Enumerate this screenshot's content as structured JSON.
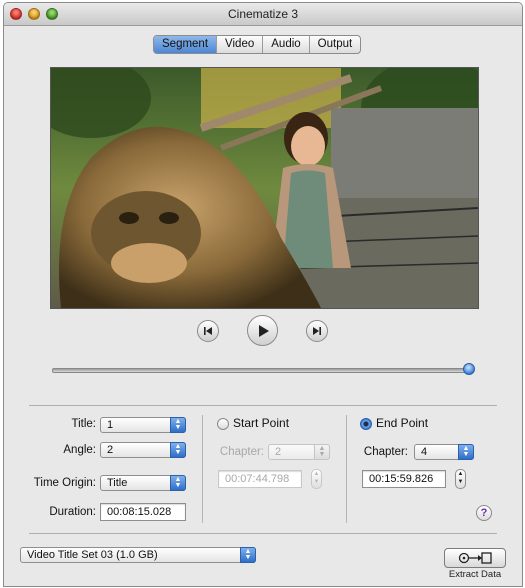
{
  "window": {
    "title": "Cinematize 3"
  },
  "tabs": [
    {
      "label": "Segment",
      "active": true
    },
    {
      "label": "Video",
      "active": false
    },
    {
      "label": "Audio",
      "active": false
    },
    {
      "label": "Output",
      "active": false
    }
  ],
  "playback": {
    "previous_icon": "skip-back-icon",
    "play_icon": "play-icon",
    "next_icon": "skip-forward-icon",
    "position_fraction": 1.0
  },
  "settings": {
    "title_label": "Title:",
    "title_value": "1",
    "angle_label": "Angle:",
    "angle_value": "2",
    "time_origin_label": "Time Origin:",
    "time_origin_value": "Title",
    "duration_label": "Duration:",
    "duration_value": "00:08:15.028"
  },
  "start_point": {
    "label": "Start Point",
    "selected": false,
    "chapter_label": "Chapter:",
    "chapter_value": "2",
    "time_value": "00:07:44.798"
  },
  "end_point": {
    "label": "End Point",
    "selected": true,
    "chapter_label": "Chapter:",
    "chapter_value": "4",
    "time_value": "00:15:59.826"
  },
  "bottom": {
    "title_set_value": "Video Title Set 03 (1.0 GB)",
    "extract_label": "Extract Data",
    "extract_icon": "extract-data-icon",
    "help_label": "?"
  },
  "colors": {
    "accent": "#3a7fd8",
    "window_bg": "#e8e8e8"
  }
}
